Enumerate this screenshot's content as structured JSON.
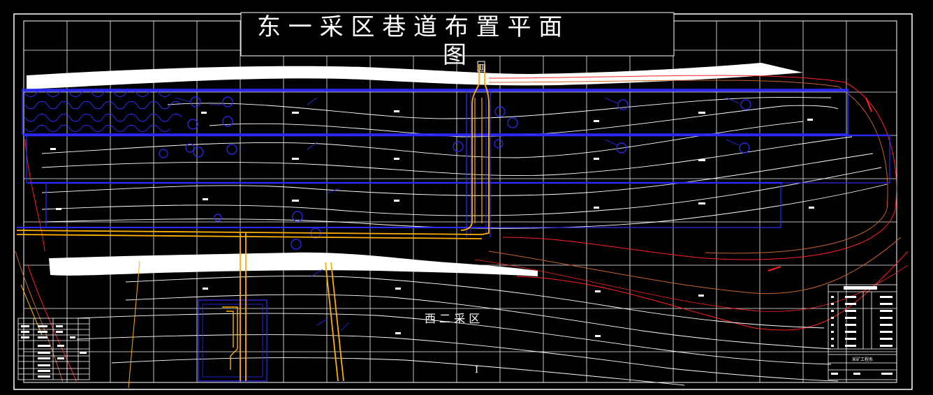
{
  "drawing": {
    "title_line1": "东  一 采 区 巷 道 布 置 平 面",
    "title_line2": "图",
    "area_label_west2": "西 二 采 区",
    "north_marker_top": "Ⅱ",
    "north_marker_bottom": "Ⅰ",
    "right_table_caption": "采矿工程系"
  },
  "colors": {
    "background": "#000000",
    "grid": "#ffffff",
    "roadway": "#2b2bff",
    "haulage": "#ffb000",
    "contour": "#ffffff",
    "boundary": "#ff2020",
    "boundary_secondary": "#c86428",
    "outcrop": "#ffffff"
  }
}
